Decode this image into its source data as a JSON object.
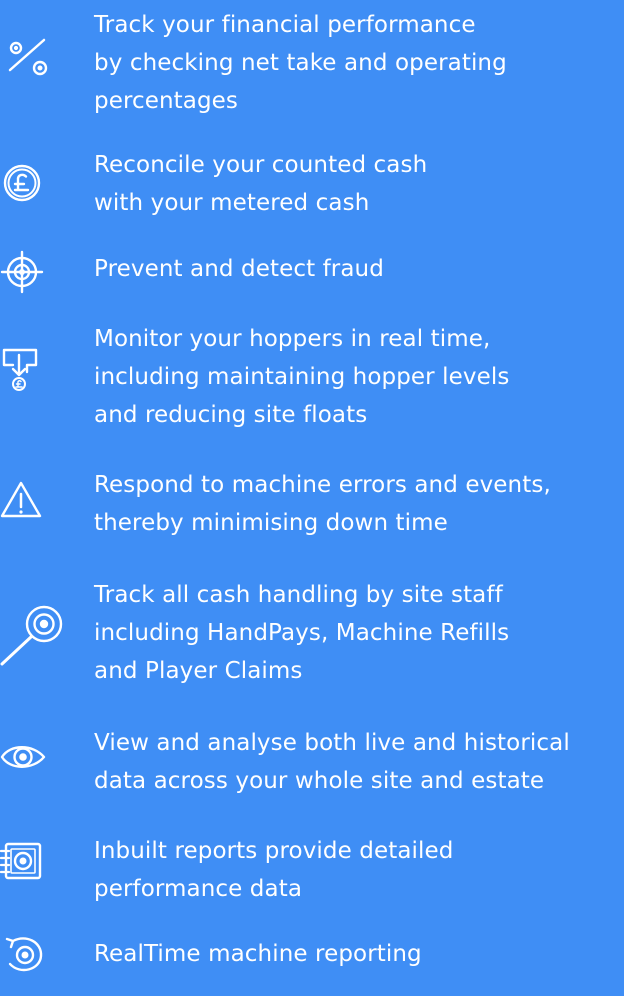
{
  "features": [
    {
      "icon": "percentage-icon",
      "lines": [
        "Track your financial performance",
        "by checking net take and operating",
        "percentages"
      ]
    },
    {
      "icon": "pound-coin-icon",
      "lines": [
        "Reconcile your counted cash",
        "with your metered cash"
      ]
    },
    {
      "icon": "target-crosshair-icon",
      "lines": [
        "Prevent and detect fraud"
      ]
    },
    {
      "icon": "hopper-icon",
      "lines": [
        "Monitor your hoppers in real time,",
        "including maintaining hopper levels",
        "and reducing site floats"
      ]
    },
    {
      "icon": "warning-icon",
      "lines": [
        "Respond to machine errors and events,",
        "thereby minimising down time"
      ]
    },
    {
      "icon": "magnifier-icon",
      "lines": [
        "Track all cash handling by site staff",
        "including HandPays, Machine Refills",
        "and Player Claims"
      ]
    },
    {
      "icon": "eye-icon",
      "lines": [
        "View and analyse both live and historical",
        "data across your whole site and estate"
      ]
    },
    {
      "icon": "report-notebook-icon",
      "lines": [
        "Inbuilt reports provide detailed",
        "performance data"
      ]
    },
    {
      "icon": "realtime-refresh-icon",
      "lines": [
        "RealTime machine reporting"
      ]
    }
  ]
}
